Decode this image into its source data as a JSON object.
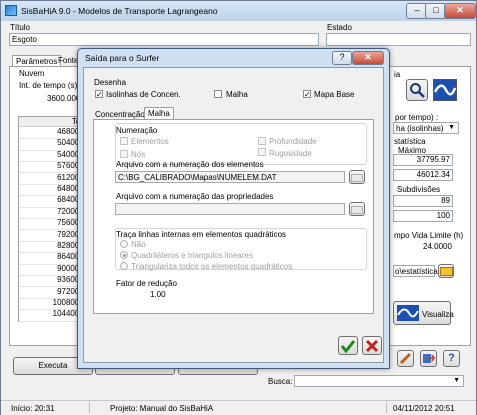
{
  "app": {
    "title": "SisBaHiA 9.0 - Modelos de Transporte Lagrangeano"
  },
  "main": {
    "titulo_label": "Título",
    "titulo_value": "Esgoto",
    "estado_label": "Estado",
    "tabs": [
      "Parâmetros",
      "Fonte"
    ],
    "nuvem_label": "Nuvem",
    "int_tempo_label": "Int. de tempo (s)",
    "int_tempo_value": "3600.0000",
    "grid_header": "Tem",
    "grid_values": [
      "46800.0",
      "50400.0",
      "54000.0",
      "57600.0",
      "61200.0",
      "64800.0",
      "68400.0",
      "72000.0",
      "75600.0",
      "79200.0",
      "82800.0",
      "86400.0",
      "90000.0",
      "93600.0",
      "97200.0",
      "100800.0",
      "104400.0"
    ],
    "right_tab_fragment": "ia",
    "por_tempo_label": "por tempo) :",
    "combo_value": "ha (isolinhas)",
    "estatistica_label": "statística",
    "maximo_label": "Máximo",
    "val1": "37795.97",
    "val2": "46012.34",
    "subdivisoes_label": "Subdivisões",
    "val3": "89",
    "val4": "100",
    "vida_label": "mpo Vida Limite (h)",
    "vida_value": "24.0000",
    "path_fragment": "o\\estatística",
    "visualiza_label": "Visualiza",
    "executa_label": "Executa",
    "busca_label": "Busca:"
  },
  "status": {
    "inicio": "Início: 20:31",
    "projeto": "Projeto: Manual do SisBaHiA",
    "data": "04/11/2012 20:51"
  },
  "dialog": {
    "title": "Saída para o Surfer",
    "desenha_label": "Desenha",
    "isolinhas_label": "Isolinhas de Concen.",
    "malha_check_label": "Malha",
    "mapa_base_label": "Mapa Base",
    "tab_concentracao": "Concentração",
    "tab_malha": "Malha",
    "numeracao_label": "Numeração",
    "elementos_label": "Elementos",
    "profundidade_label": "Profundidade",
    "nos_label": "Nós",
    "rugosidade_label": "Rugosidade",
    "arq_elementos_label": "Arquivo com a numeração dos elementos",
    "arq_elementos_value": "C:\\BG_CALIBRADO\\Mapas\\NUMELEM.DAT",
    "arq_propriedades_label": "Arquivo com a numeração das propriedades",
    "arq_propriedades_value": "",
    "traca_label": "Traça linhas internas em elementos quadráticos",
    "opt_nao": "Não",
    "opt_quad": "Quadriláteros e triangulos lineares",
    "opt_triang": "Triangulariza todos os elementos quadráticos",
    "fator_label": "Fator de redução",
    "fator_value": "1.00"
  }
}
